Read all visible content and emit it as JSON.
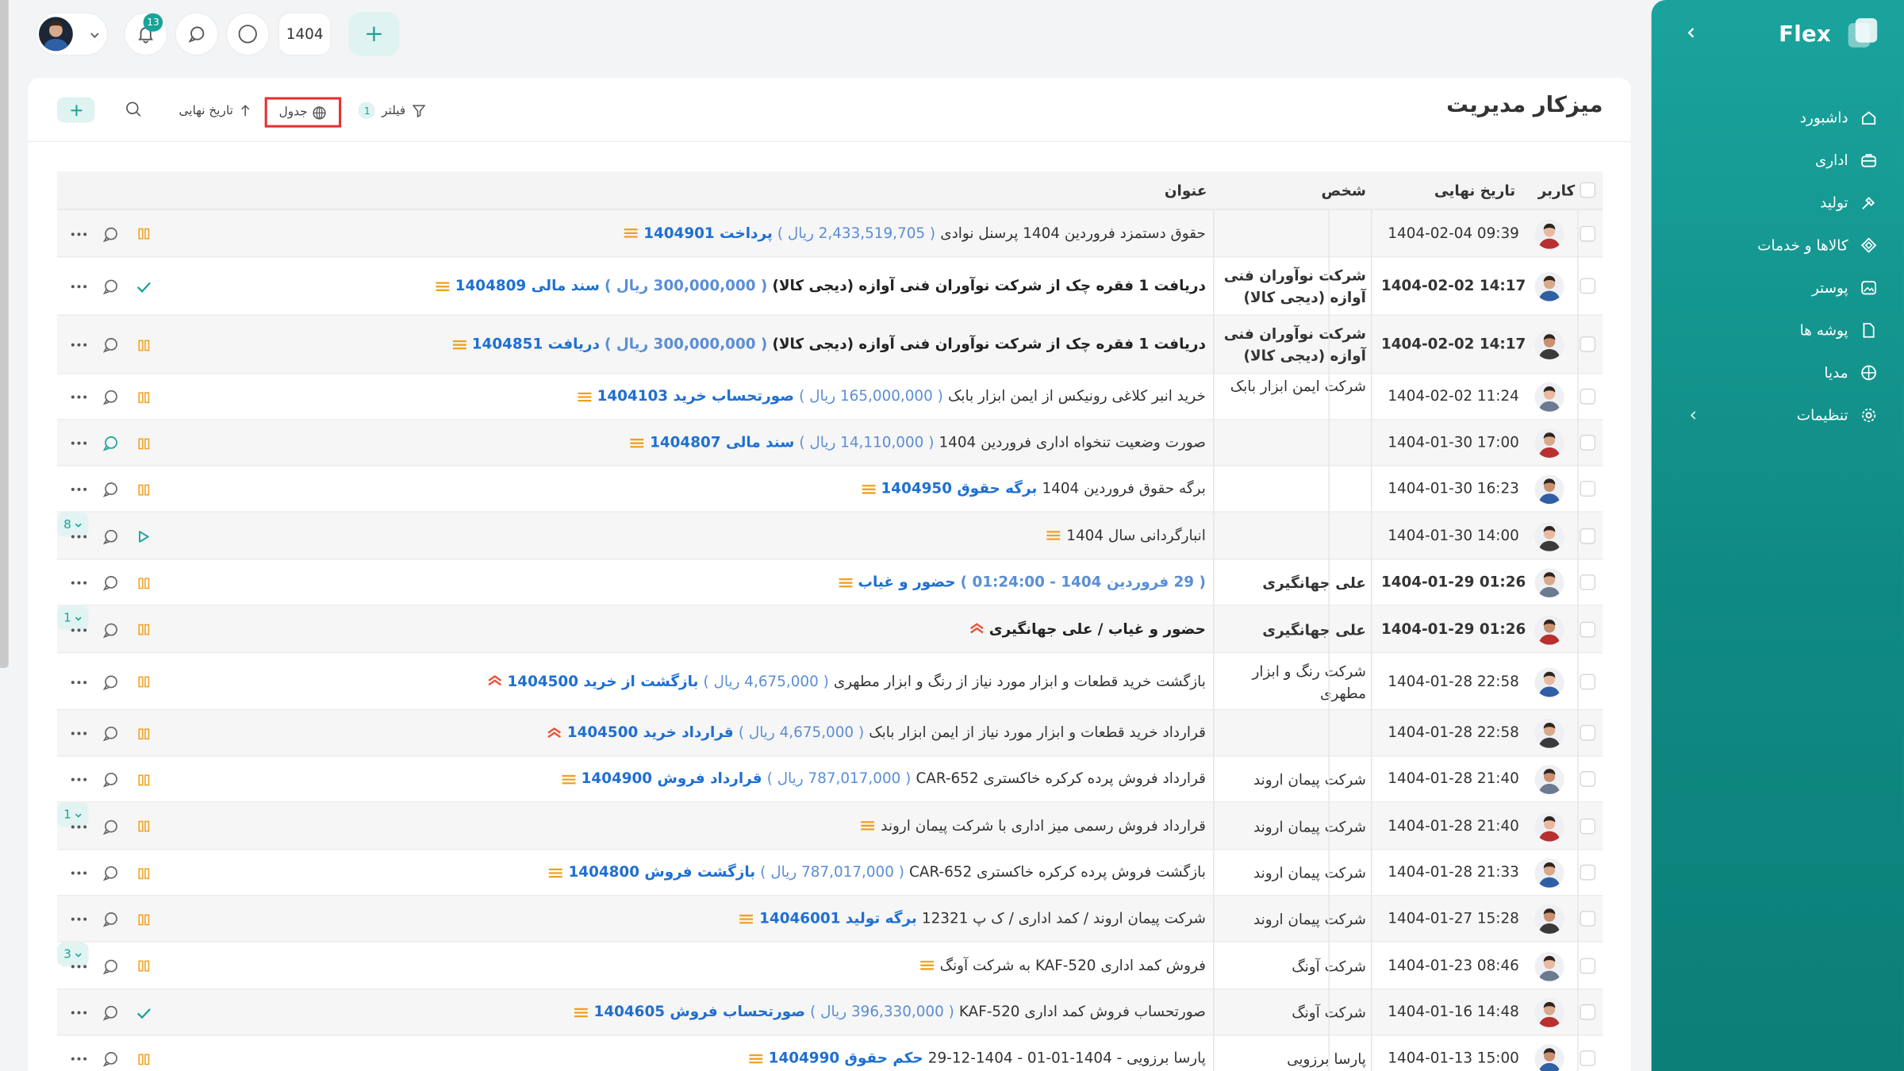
{
  "app": {
    "brand": "Flex",
    "page_title": "میزکار مدیریت"
  },
  "topbar": {
    "notification_count": "13",
    "year": "1404"
  },
  "toolbar": {
    "filter_label": "فیلتر",
    "filter_count": "1",
    "table_label": "جدول",
    "sort_label": "تاریخ نهایی"
  },
  "sidebar": {
    "items": [
      {
        "label": "داشبورد",
        "icon": "home-icon"
      },
      {
        "label": "اداری",
        "icon": "briefcase-icon"
      },
      {
        "label": "تولید",
        "icon": "hammer-icon"
      },
      {
        "label": "کالاها و خدمات",
        "icon": "diamond-icon"
      },
      {
        "label": "پوستر",
        "icon": "image-icon"
      },
      {
        "label": "پوشه ها",
        "icon": "file-icon"
      },
      {
        "label": "مدیا",
        "icon": "grid-icon"
      },
      {
        "label": "تنظیمات",
        "icon": "gear-icon"
      }
    ]
  },
  "table": {
    "headers": {
      "user": "کاربر",
      "due_date": "تاریخ نهایی",
      "person": "شخص",
      "title": "عنوان"
    },
    "rows": [
      {
        "date": "1404-02-04 09:39",
        "person": "",
        "bold": false,
        "pri": "med",
        "link": "پرداخت 1404901",
        "amount": "( 2,433,519,705 ریال )",
        "text": "حقوق دستمزد فروردین 1404 پرسنل نوادی",
        "status": "pause",
        "count": ""
      },
      {
        "date": "1404-02-02 14:17",
        "person": "شرکت نوآوران فنی آوازه (دیجی کالا)",
        "bold": true,
        "pri": "med",
        "link": "سند مالی 1404809",
        "amount": "( 300,000,000 ریال )",
        "text": "دریافت 1 فقره چک از شرکت نوآوران فنی آوازه (دیجی کالا)",
        "status": "check",
        "count": ""
      },
      {
        "date": "1404-02-02 14:17",
        "person": "شرکت نوآوران فنی آوازه (دیجی کالا)",
        "bold": true,
        "pri": "med",
        "link": "دریافت 1404851",
        "amount": "( 300,000,000 ریال )",
        "text": "دریافت 1 فقره چک از شرکت نوآوران فنی آوازه (دیجی کالا)",
        "status": "pause",
        "count": ""
      },
      {
        "date": "1404-02-02 11:24",
        "person": "شرکت ایمن ابزار بابک",
        "bold": false,
        "pri": "med",
        "link": "صورتحساب خرید 1404103",
        "amount": "( 165,000,000 ریال )",
        "text": "خرید انبر کلاغی رونیکس از ایمن ابزار بابک",
        "status": "pause",
        "count": ""
      },
      {
        "date": "1404-01-30 17:00",
        "person": "",
        "bold": false,
        "pri": "med",
        "link": "سند مالی 1404807",
        "amount": "( 14,110,000 ریال )",
        "text": "صورت وضعیت تنخواه اداری فروردین 1404",
        "status": "pause",
        "count": "",
        "chat_green": true
      },
      {
        "date": "1404-01-30 16:23",
        "person": "",
        "bold": false,
        "pri": "med",
        "link": "برگه حقوق 1404950",
        "amount": "",
        "text": "برگه حقوق فروردین 1404",
        "status": "pause",
        "count": ""
      },
      {
        "date": "1404-01-30 14:00",
        "person": "",
        "bold": false,
        "pri": "med",
        "link": "",
        "amount": "",
        "text": "انبارگردانی سال 1404",
        "status": "play",
        "count": "8"
      },
      {
        "date": "1404-01-29 01:26",
        "person": "علی جهانگیری",
        "bold": true,
        "pri": "med",
        "link": "حضور و غیاب",
        "amount": "( 29 فروردین 1404 - 01:24:00 )",
        "text": "",
        "status": "pause",
        "count": ""
      },
      {
        "date": "1404-01-29 01:26",
        "person": "علی جهانگیری",
        "bold": true,
        "pri": "high",
        "link": "",
        "amount": "",
        "text": "حضور و غیاب / علی جهانگیری",
        "status": "pause",
        "count": "1"
      },
      {
        "date": "1404-01-28 22:58",
        "person": "شرکت رنگ و ابزار مطهری",
        "bold": false,
        "pri": "high",
        "link": "بازگشت از خرید 1404500",
        "amount": "( 4,675,000 ریال )",
        "text": "بازگشت خرید قطعات و ابزار مورد نیاز از رنگ و ابزار مطهری",
        "status": "pause",
        "count": ""
      },
      {
        "date": "1404-01-28 22:58",
        "person": "",
        "bold": false,
        "pri": "high",
        "link": "قرارداد خرید 1404500",
        "amount": "( 4,675,000 ریال )",
        "text": "قرارداد خرید قطعات و ابزار مورد نیاز از ایمن ابزار بابک",
        "status": "pause",
        "count": ""
      },
      {
        "date": "1404-01-28 21:40",
        "person": "شرکت پیمان اروند",
        "bold": false,
        "pri": "med",
        "link": "قرارداد فروش 1404900",
        "amount": "( 787,017,000 ریال )",
        "text": "قرارداد فروش پرده کرکره خاکستری CAR-652",
        "status": "pause",
        "count": ""
      },
      {
        "date": "1404-01-28 21:40",
        "person": "شرکت پیمان اروند",
        "bold": false,
        "pri": "med",
        "link": "",
        "amount": "",
        "text": "قرارداد فروش رسمی میز اداری با شرکت پیمان اروند",
        "status": "pause",
        "count": "1"
      },
      {
        "date": "1404-01-28 21:33",
        "person": "شرکت پیمان اروند",
        "bold": false,
        "pri": "med",
        "link": "بازگشت فروش 1404800",
        "amount": "( 787,017,000 ریال )",
        "text": "بازگشت فروش پرده کرکره خاکستری CAR-652",
        "status": "pause",
        "count": ""
      },
      {
        "date": "1404-01-27 15:28",
        "person": "شرکت پیمان اروند",
        "bold": false,
        "pri": "med",
        "link": "برگه تولید 14046001",
        "amount": "",
        "text": "شرکت پیمان اروند / کمد اداری / ک پ 12321",
        "status": "pause",
        "count": ""
      },
      {
        "date": "1404-01-23 08:46",
        "person": "شرکت آونگ",
        "bold": false,
        "pri": "med",
        "link": "",
        "amount": "",
        "text": "فروش کمد اداری KAF-520 به شرکت آونگ",
        "status": "pause",
        "count": "3"
      },
      {
        "date": "1404-01-16 14:48",
        "person": "شرکت آونگ",
        "bold": false,
        "pri": "med",
        "link": "صورتحساب فروش 1404605",
        "amount": "( 396,330,000 ریال )",
        "text": "صورتحساب فروش کمد اداری KAF-520",
        "status": "check",
        "count": ""
      },
      {
        "date": "1404-01-13 15:00",
        "person": "پارسا برزویی",
        "bold": false,
        "pri": "med",
        "link": "حکم حقوق 1404990",
        "amount": "",
        "text": "پارسا برزویی - 1404-01-01 - 1404-12-29",
        "status": "pause",
        "count": ""
      }
    ]
  },
  "colors": {
    "brand": "#17a399",
    "link": "#1f6fd1",
    "amount": "#5a8ed6",
    "priority_medium": "#f0a020",
    "priority_high": "#e8553e",
    "highlight_border": "#e53030"
  }
}
